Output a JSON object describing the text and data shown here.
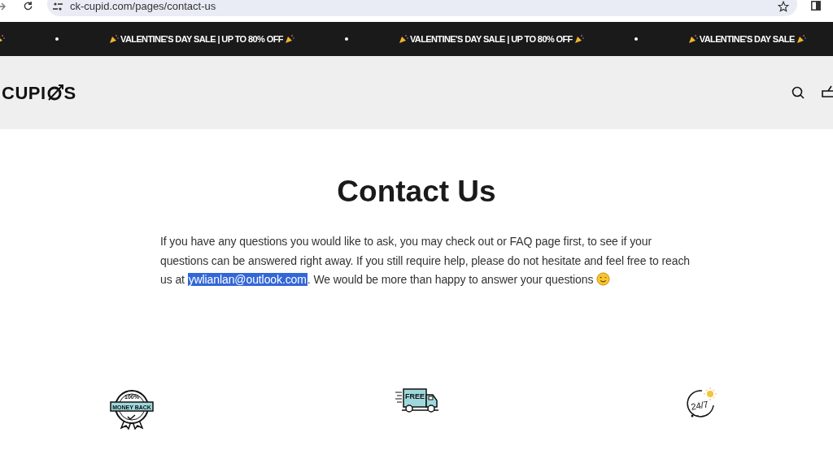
{
  "browser": {
    "url": "ck-cupid.com/pages/contact-us"
  },
  "announcement": {
    "items": [
      {
        "text": "VALENTINE'S DAY SALE | UP TO 80% OFF"
      },
      {
        "text": "VALENTINE'S DAY SALE | UP TO 80% OFF"
      },
      {
        "text": "VALENTINE'S DAY SALE"
      }
    ]
  },
  "header": {
    "logo_before": "CUPI",
    "logo_after": "S"
  },
  "page": {
    "title": "Contact Us",
    "text_before": "If you have any questions you would like to ask, you may check out or FAQ page first, to see if your questions can be answered right away. If you still require help, please do not hesitate and feel free to reach us at ",
    "email": "ywlianlan@outlook.com",
    "email_selected": true,
    "text_after": ". We would be more than happy to answer your questions"
  },
  "features": [
    {
      "kind": "badge",
      "lines": [
        "100%",
        "MONEY BACK"
      ]
    },
    {
      "kind": "truck",
      "lines": [
        "FREE"
      ]
    },
    {
      "kind": "support",
      "lines": [
        "24/7"
      ]
    }
  ]
}
